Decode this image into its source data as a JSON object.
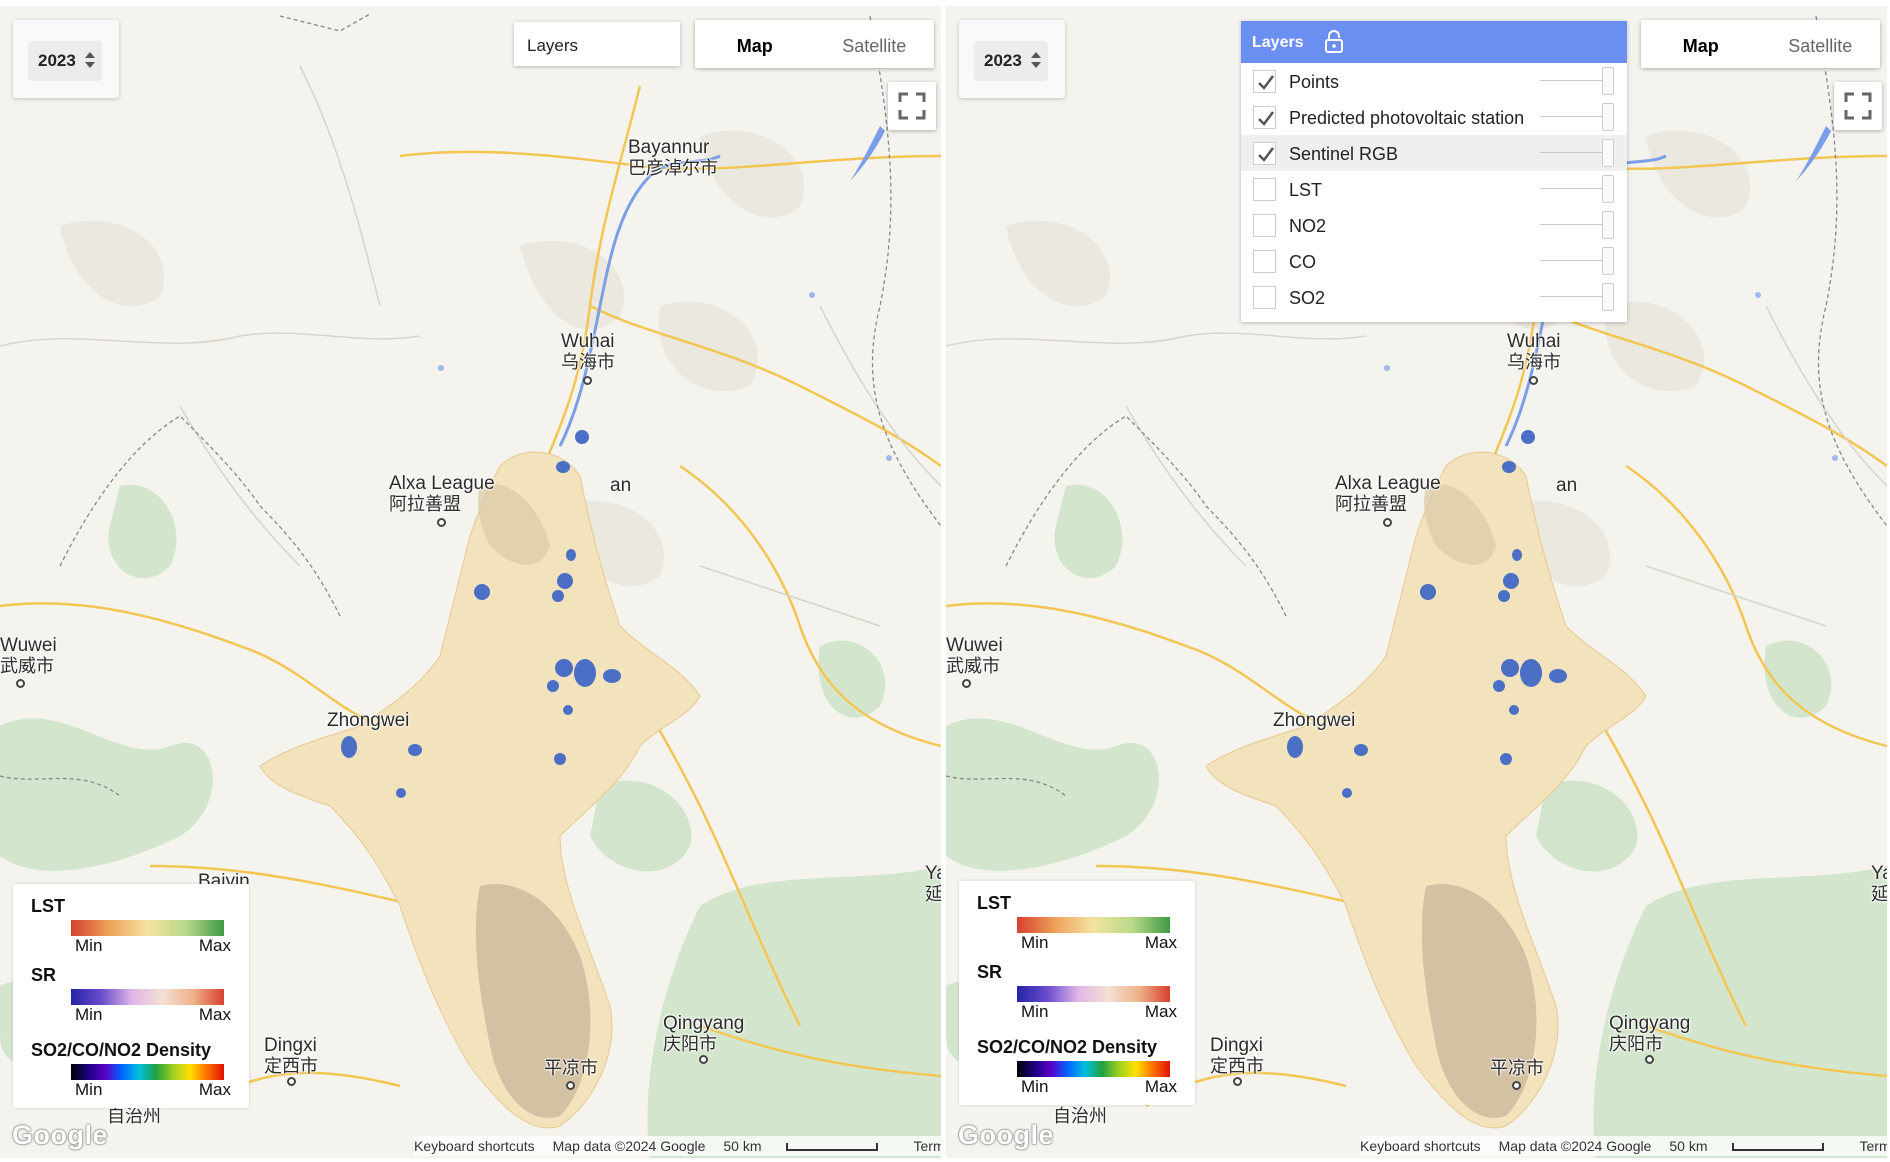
{
  "left_panel": {
    "year_select": {
      "value": "2023"
    },
    "layers_button": {
      "label": "Layers"
    },
    "map_type": {
      "tabs": [
        "Map",
        "Satellite"
      ],
      "active": "Map"
    },
    "legend": {
      "items": [
        {
          "title": "LST",
          "min": "Min",
          "max": "Max"
        },
        {
          "title": "SR",
          "min": "Min",
          "max": "Max"
        },
        {
          "title": "SO2/CO/NO2 Density",
          "min": "Min",
          "max": "Max"
        }
      ]
    },
    "footer": {
      "shortcuts": "Keyboard shortcuts",
      "map_data": "Map data ©2024 Google",
      "scale": "50 km",
      "terms": "Terms"
    },
    "logo": "Google"
  },
  "right_panel": {
    "year_select": {
      "value": "2023"
    },
    "layers_panel": {
      "title": "Layers",
      "layers": [
        {
          "name": "Points",
          "checked": true
        },
        {
          "name": "Predicted photovoltaic station",
          "checked": true
        },
        {
          "name": "Sentinel RGB",
          "checked": true
        },
        {
          "name": "LST",
          "checked": false
        },
        {
          "name": "NO2",
          "checked": false
        },
        {
          "name": "CO",
          "checked": false
        },
        {
          "name": "SO2",
          "checked": false
        }
      ]
    },
    "map_type": {
      "tabs": [
        "Map",
        "Satellite"
      ],
      "active": "Map"
    },
    "legend": {
      "items": [
        {
          "title": "LST",
          "min": "Min",
          "max": "Max"
        },
        {
          "title": "SR",
          "min": "Min",
          "max": "Max"
        },
        {
          "title": "SO2/CO/NO2 Density",
          "min": "Min",
          "max": "Max"
        }
      ]
    },
    "footer": {
      "shortcuts": "Keyboard shortcuts",
      "map_data": "Map data ©2024 Google",
      "scale": "50 km",
      "terms": "Terms"
    },
    "logo": "Google"
  },
  "map_labels": {
    "bayannur": {
      "en": "Bayannur",
      "zh": "巴彦淖尔市"
    },
    "wuhai": {
      "en": "Wuhai",
      "zh": "乌海市"
    },
    "alxa": {
      "en": "Alxa League",
      "zh": "阿拉善盟"
    },
    "wuwei": {
      "en": "Wuwei",
      "zh": "武威市"
    },
    "zhongwei": {
      "en": "Zhongwei",
      "zh": ""
    },
    "baiyin": {
      "en": "Baiyin",
      "zh": ""
    },
    "dingxi": {
      "en": "Dingxi",
      "zh": "定西市"
    },
    "qingyang": {
      "en": "Qingyang",
      "zh": "庆阳市"
    },
    "pingliang": {
      "en": "",
      "zh": "平凉市"
    },
    "zizhizhou": {
      "en": "",
      "zh": "自治州"
    },
    "yan": {
      "en": "Ya",
      "zh": "延"
    },
    "an": {
      "en": "an",
      "zh": ""
    }
  },
  "colors": {
    "map_background": "#f5f3ee",
    "layers_header": "#6b8ff0",
    "pv_points": "#4a6fc4",
    "roads": "#f5c24a"
  }
}
